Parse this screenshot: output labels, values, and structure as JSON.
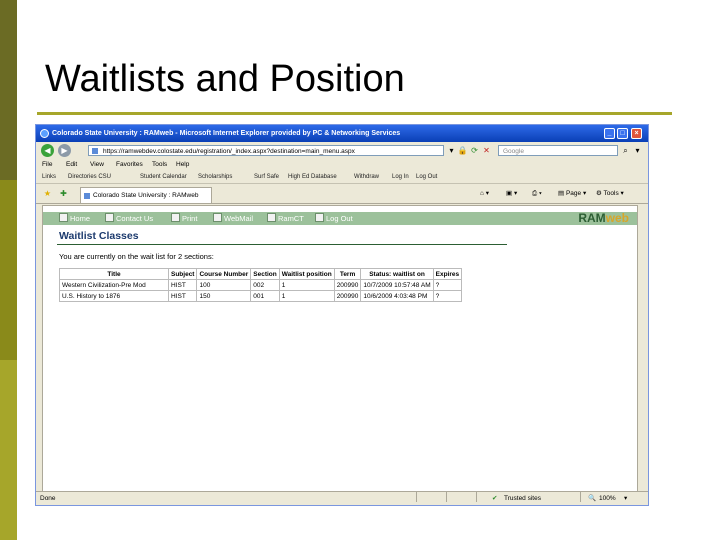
{
  "slide": {
    "title": "Waitlists and Position"
  },
  "browser": {
    "window_title": "Colorado State University : RAMweb - Microsoft Internet Explorer provided by PC & Networking Services",
    "address": "https://ramwebdev.colostate.edu/registration/_index.aspx?destination=main_menu.aspx",
    "search_placeholder": "Google",
    "menu": [
      "File",
      "Edit",
      "View",
      "Favorites",
      "Tools",
      "Help"
    ],
    "links": [
      "Links",
      "Directories CSU",
      "Student Calendar",
      "Scholarships",
      "Surf Safe",
      "High Ed Database",
      "Withdraw",
      "Log In",
      "Log Out"
    ],
    "tab_title": "Colorado State University : RAMweb",
    "toolbar_right": {
      "page": "Page",
      "tools": "Tools"
    },
    "status": {
      "left": "Done",
      "zone": "Trusted sites",
      "zoom": "100%"
    }
  },
  "ramweb": {
    "nav": [
      "Home",
      "Contact Us",
      "Print",
      "WebMail",
      "RamCT",
      "Log Out"
    ],
    "logo": {
      "part1": "RAM",
      "part2": "web"
    },
    "heading": "Waitlist Classes",
    "intro": "You are currently on the wait list for 2 sections:",
    "table": {
      "headers": [
        "Title",
        "Subject",
        "Course Number",
        "Section",
        "Waitlist position",
        "Term",
        "Status: waitlist on",
        "Expires"
      ],
      "rows": [
        [
          "Western Civilization-Pre Mod",
          "HIST",
          "100",
          "002",
          "1",
          "200990",
          "10/7/2009 10:57:48 AM",
          "?"
        ],
        [
          "U.S. History to 1876",
          "HIST",
          "150",
          "001",
          "1",
          "200990",
          "10/6/2009 4:03:48 PM",
          "?"
        ]
      ]
    }
  },
  "colors": {
    "sidebar_dark": "#6b6b24",
    "sidebar_mid": "#8a8a1a",
    "sidebar_light": "#a6a62a",
    "banner": "#9cc19b",
    "heading": "#1d3b6e"
  }
}
